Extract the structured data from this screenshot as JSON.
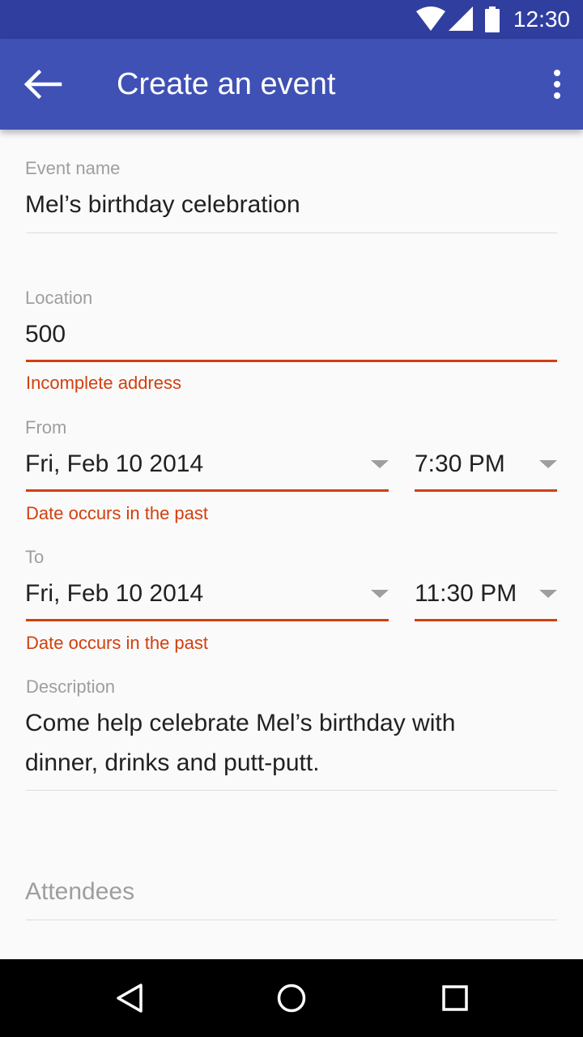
{
  "status_bar": {
    "time": "12:30",
    "icons": [
      "wifi-icon",
      "signal-icon",
      "battery-icon"
    ]
  },
  "app_bar": {
    "title": "Create an event",
    "back_icon": "arrow-back-icon",
    "menu_icon": "more-vert-icon"
  },
  "form": {
    "event_name": {
      "label": "Event name",
      "value": "Mel’s birthday celebration"
    },
    "location": {
      "label": "Location",
      "value": "500",
      "error": "Incomplete address"
    },
    "from": {
      "label": "From",
      "date": "Fri, Feb 10 2014",
      "time": "7:30 PM",
      "error": "Date occurs in the past"
    },
    "to": {
      "label": "To",
      "date": "Fri, Feb 10 2014",
      "time": "11:30 PM",
      "error": "Date occurs in the past"
    },
    "description": {
      "label": "Description",
      "line1": "Come help celebrate Mel’s birthday with",
      "line2": "dinner, drinks and putt-putt."
    },
    "attendees": {
      "placeholder": "Attendees"
    }
  },
  "colors": {
    "primary": "#3f51b5",
    "primary_dark": "#303f9f",
    "error": "#d23f0e",
    "hint": "#9e9e9e"
  },
  "nav_bar": {
    "icons": [
      "back-triangle-icon",
      "home-circle-icon",
      "recents-square-icon"
    ]
  }
}
